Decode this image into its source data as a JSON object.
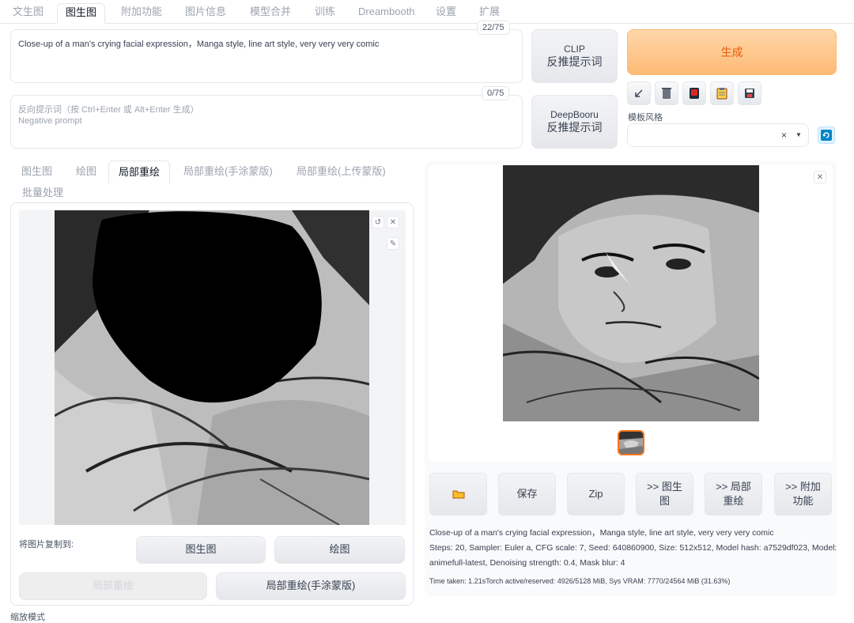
{
  "top_tabs": [
    "文生图",
    "图生图",
    "附加功能",
    "图片信息",
    "模型合并",
    "训练",
    "Dreambooth",
    "设置",
    "扩展"
  ],
  "prompt": {
    "value": "Close-up of a man's crying  facial expression，Manga style, line art style, very very very comic",
    "counter": "22/75"
  },
  "negative_prompt": {
    "placeholder_line1": "反向提示词（按 Ctrl+Enter 或 Alt+Enter 生成）",
    "placeholder_line2": "Negative prompt",
    "counter": "0/75"
  },
  "interrogate": {
    "clip_line1": "CLIP",
    "clip_line2": "反推提示词",
    "deepbooru_line1": "DeepBooru",
    "deepbooru_line2": "反推提示词"
  },
  "generate_label": "生成",
  "tool_icons": [
    "arrow-icon",
    "trash-icon",
    "red-card-icon",
    "clipboard-icon",
    "save-icon"
  ],
  "styles_label": "模板风格",
  "img2img_tabs": [
    "图生图",
    "绘图",
    "局部重绘",
    "局部重绘(手涂蒙版)",
    "局部重绘(上传蒙版)",
    "批量处理"
  ],
  "copy_to": {
    "label": "将图片复制到:",
    "buttons": [
      "图生图",
      "绘图",
      "局部重绘",
      "局部重绘(手涂蒙版)"
    ]
  },
  "resize_mode_label": "缩放模式",
  "gallery_buttons": [
    "保存",
    "Zip",
    ">> 图生图",
    ">> 局部重绘",
    ">> 附加功能"
  ],
  "generation_info": {
    "prompt": "Close-up of a man's crying facial expression，Manga style, line art style, very very very comic",
    "params_line1": "Steps: 20, Sampler: Euler a, CFG scale: 7, Seed: 640860900, Size: 512x512, Model hash: a7529df023, Model:",
    "params_line2": "animefull-latest, Denoising strength: 0.4, Mask blur: 4",
    "time": "Time taken: 1.21sTorch active/reserved: 4926/5128 MiB, Sys VRAM: 7770/24564 MiB (31.63%)"
  },
  "colors": {
    "accent": "#f97316",
    "generate_bg": "#fdba74",
    "refresh_blue": "#0284c7"
  }
}
